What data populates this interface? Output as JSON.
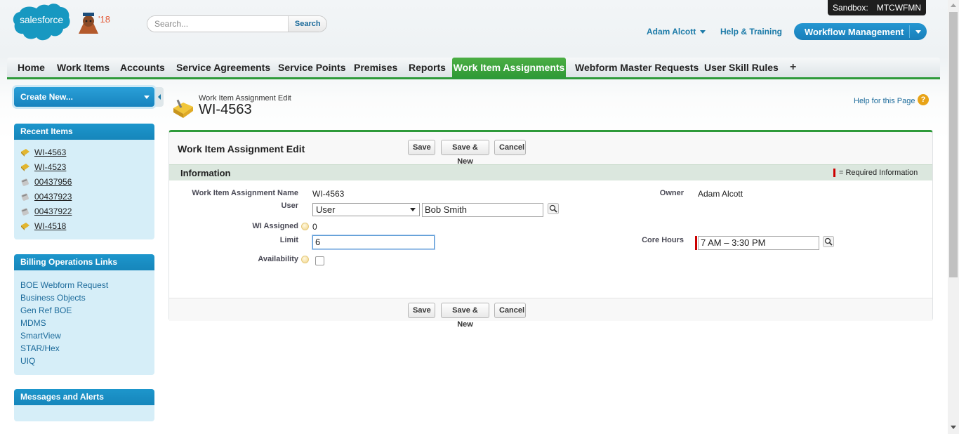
{
  "header": {
    "logo_text": "salesforce",
    "release_badge": "'18",
    "sandbox_label": "Sandbox:",
    "sandbox_name": "MTCWFMN",
    "search_placeholder": "Search...",
    "search_button": "Search",
    "user_name": "Adam Alcott",
    "help_link": "Help & Training",
    "app_menu": "Workflow Management"
  },
  "tabs": [
    {
      "label": "Home"
    },
    {
      "label": "Work Items"
    },
    {
      "label": "Accounts"
    },
    {
      "label": "Service Agreements"
    },
    {
      "label": "Service Points"
    },
    {
      "label": "Premises"
    },
    {
      "label": "Reports"
    },
    {
      "label": "Work Item Assignments",
      "active": true
    },
    {
      "label": "Webform Master Requests"
    },
    {
      "label": "User Skill Rules"
    }
  ],
  "tab_plus": "+",
  "sidebar": {
    "create_new": "Create New...",
    "recent_title": "Recent Items",
    "recent_items": [
      {
        "label": "WI-4563",
        "icon": "assignment-icon"
      },
      {
        "label": "WI-4523",
        "icon": "assignment-icon"
      },
      {
        "label": "00437956",
        "icon": "work-item-icon"
      },
      {
        "label": "00437923",
        "icon": "work-item-icon"
      },
      {
        "label": "00437922",
        "icon": "work-item-icon"
      },
      {
        "label": "WI-4518",
        "icon": "assignment-icon"
      }
    ],
    "billing_title": "Billing Operations Links",
    "billing_links": [
      "BOE Webform Request",
      "Business Objects",
      "Gen Ref BOE",
      "MDMS",
      "SmartView",
      "STAR/Hex",
      "UIQ"
    ],
    "messages_title": "Messages and Alerts"
  },
  "page": {
    "type_label": "Work Item Assignment Edit",
    "title": "WI-4563",
    "help_link": "Help for this Page",
    "help_glyph": "?"
  },
  "edit": {
    "heading": "Work Item Assignment Edit",
    "save": "Save",
    "save_new": "Save & New",
    "cancel": "Cancel",
    "section": "Information",
    "required_text": "= Required Information",
    "fields": {
      "name_label": "Work Item Assignment Name",
      "name_value": "WI-4563",
      "user_label": "User",
      "user_type": "User",
      "user_value": "Bob Smith",
      "wi_assigned_label": "WI Assigned",
      "wi_assigned_value": "0",
      "limit_label": "Limit",
      "limit_value": "6",
      "availability_label": "Availability",
      "availability_checked": false,
      "owner_label": "Owner",
      "owner_value": "Adam Alcott",
      "core_hours_label": "Core Hours",
      "core_hours_value": "7 AM – 3:30 PM"
    }
  },
  "colors": {
    "accent_blue": "#1d96cc",
    "tab_active_green": "#2f9a36",
    "link_blue": "#1b6a9a",
    "required_red": "#cc0000"
  }
}
